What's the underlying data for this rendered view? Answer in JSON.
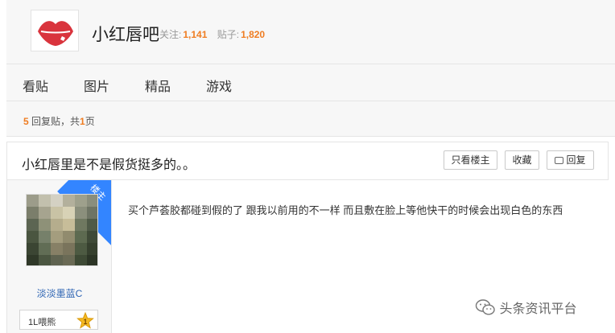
{
  "forum": {
    "name": "小红唇吧",
    "follow_label": "关注:",
    "follow_count": "1,141",
    "posts_label": "贴子:",
    "posts_count": "1,820"
  },
  "nav": {
    "tabs": [
      {
        "label": "看贴"
      },
      {
        "label": "图片"
      },
      {
        "label": "精品"
      },
      {
        "label": "游戏"
      }
    ]
  },
  "reply_summary": {
    "count": "5",
    "text_middle": " 回复贴，共",
    "pages": "1",
    "text_end": "页"
  },
  "thread": {
    "title": "小红唇里是不是假货挺多的。。",
    "buttons": {
      "only_op": "只看楼主",
      "favorite": "收藏",
      "reply": "回复"
    }
  },
  "post": {
    "op_badge": "楼主",
    "username": "淡淡墨蓝C",
    "level_text": "1L喂熊",
    "level_number": "1",
    "content": "买个芦荟胶都碰到假的了 跟我以前用的不一样 而且敷在脸上等他快干的时候会出现白色的东西"
  },
  "watermark": {
    "text": "头条资讯平台"
  },
  "colors": {
    "accent_orange": "#ef7d22",
    "link_blue": "#2d64b3",
    "op_flag_blue": "#3385ff",
    "logo_red": "#d9343d"
  },
  "icons": [
    "lips-logo-icon",
    "reply-icon",
    "star-level-icon",
    "wechat-icon"
  ]
}
